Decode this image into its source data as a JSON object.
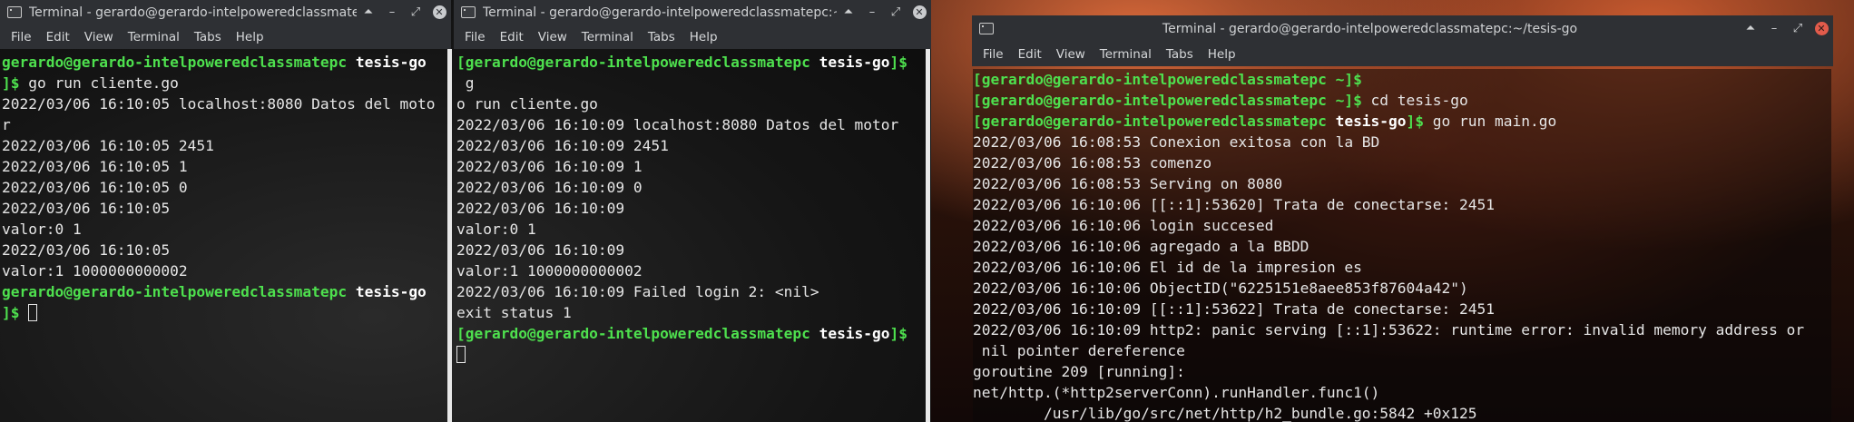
{
  "desktop": {
    "wallpaper_colors": [
      "#d9693a",
      "#7a2c17",
      "#120807"
    ]
  },
  "windows": [
    {
      "title": "Terminal - gerardo@gerardo-intelpoweredclassmatepc:~/",
      "menu": [
        "File",
        "Edit",
        "View",
        "Terminal",
        "Tabs",
        "Help"
      ],
      "lines": [
        [
          [
            "g",
            "gerardo@gerardo-intelpoweredclassmatepc"
          ],
          [
            "w",
            " tesis-go"
          ]
        ],
        [
          [
            "g",
            "]$"
          ],
          [
            "t",
            " go run cliente.go"
          ]
        ],
        [
          [
            "t",
            "2022/03/06 16:10:05 localhost:8080 Datos del moto"
          ]
        ],
        [
          [
            "t",
            "r"
          ]
        ],
        [
          [
            "t",
            "2022/03/06 16:10:05 2451"
          ]
        ],
        [
          [
            "t",
            "2022/03/06 16:10:05 1"
          ]
        ],
        [
          [
            "t",
            "2022/03/06 16:10:05 0"
          ]
        ],
        [
          [
            "t",
            "2022/03/06 16:10:05"
          ]
        ],
        [
          [
            "t",
            "valor:0 1"
          ]
        ],
        [
          [
            "t",
            "2022/03/06 16:10:05"
          ]
        ],
        [
          [
            "t",
            "valor:1 1000000000002"
          ]
        ],
        [
          [
            "g",
            "gerardo@gerardo-intelpoweredclassmatepc"
          ],
          [
            "w",
            " tesis-go"
          ]
        ],
        [
          [
            "g",
            "]$"
          ],
          [
            "t",
            " "
          ],
          [
            "c",
            ""
          ]
        ]
      ]
    },
    {
      "title": "Terminal - gerardo@gerardo-intelpoweredclassmatepc:~/tes",
      "menu": [
        "File",
        "Edit",
        "View",
        "Terminal",
        "Tabs",
        "Help"
      ],
      "lines": [
        [
          [
            "g",
            "[gerardo@gerardo-intelpoweredclassmatepc"
          ],
          [
            "w",
            " tesis-go"
          ],
          [
            "g",
            "]$"
          ]
        ],
        [
          [
            "t",
            " g"
          ]
        ],
        [
          [
            "t",
            "o run cliente.go"
          ]
        ],
        [
          [
            "t",
            "2022/03/06 16:10:09 localhost:8080 Datos del motor"
          ]
        ],
        [
          [
            "t",
            "2022/03/06 16:10:09 2451"
          ]
        ],
        [
          [
            "t",
            "2022/03/06 16:10:09 1"
          ]
        ],
        [
          [
            "t",
            "2022/03/06 16:10:09 0"
          ]
        ],
        [
          [
            "t",
            "2022/03/06 16:10:09"
          ]
        ],
        [
          [
            "t",
            "valor:0 1"
          ]
        ],
        [
          [
            "t",
            "2022/03/06 16:10:09"
          ]
        ],
        [
          [
            "t",
            "valor:1 1000000000002"
          ]
        ],
        [
          [
            "t",
            "2022/03/06 16:10:09 Failed login 2: <nil>"
          ]
        ],
        [
          [
            "t",
            "exit status 1"
          ]
        ],
        [
          [
            "g",
            "[gerardo@gerardo-intelpoweredclassmatepc"
          ],
          [
            "w",
            " tesis-go"
          ],
          [
            "g",
            "]$"
          ]
        ],
        [
          [
            "c",
            ""
          ]
        ]
      ]
    },
    {
      "title": "Terminal - gerardo@gerardo-intelpoweredclassmatepc:~/tesis-go",
      "menu": [
        "File",
        "Edit",
        "View",
        "Terminal",
        "Tabs",
        "Help"
      ],
      "lines": [
        [
          [
            "g",
            "[gerardo@gerardo-intelpoweredclassmatepc ~]$"
          ]
        ],
        [
          [
            "g",
            "[gerardo@gerardo-intelpoweredclassmatepc ~]$"
          ],
          [
            "t",
            " cd tesis-go"
          ]
        ],
        [
          [
            "g",
            "[gerardo@gerardo-intelpoweredclassmatepc"
          ],
          [
            "w",
            " tesis-go"
          ],
          [
            "g",
            "]$"
          ],
          [
            "t",
            " go run main.go"
          ]
        ],
        [
          [
            "t",
            "2022/03/06 16:08:53 Conexion exitosa con la BD"
          ]
        ],
        [
          [
            "t",
            "2022/03/06 16:08:53 comenzo"
          ]
        ],
        [
          [
            "t",
            "2022/03/06 16:08:53 Serving on 8080"
          ]
        ],
        [
          [
            "t",
            "2022/03/06 16:10:06 [[::1]:53620] Trata de conectarse: 2451"
          ]
        ],
        [
          [
            "t",
            "2022/03/06 16:10:06 login succesed"
          ]
        ],
        [
          [
            "t",
            "2022/03/06 16:10:06 agregado a la BBDD"
          ]
        ],
        [
          [
            "t",
            "2022/03/06 16:10:06 El id de la impresion es"
          ]
        ],
        [
          [
            "t",
            "2022/03/06 16:10:06 ObjectID(\"6225151e8aee853f87604a42\")"
          ]
        ],
        [
          [
            "t",
            "2022/03/06 16:10:09 [[::1]:53622] Trata de conectarse: 2451"
          ]
        ],
        [
          [
            "t",
            "2022/03/06 16:10:09 http2: panic serving [::1]:53622: runtime error: invalid memory address or"
          ]
        ],
        [
          [
            "t",
            " nil pointer dereference"
          ]
        ],
        [
          [
            "t",
            "goroutine 209 [running]:"
          ]
        ],
        [
          [
            "t",
            "net/http.(*http2serverConn).runHandler.func1()"
          ]
        ],
        [
          [
            "t",
            "        /usr/lib/go/src/net/http/h2_bundle.go:5842 +0x125"
          ]
        ]
      ]
    }
  ]
}
